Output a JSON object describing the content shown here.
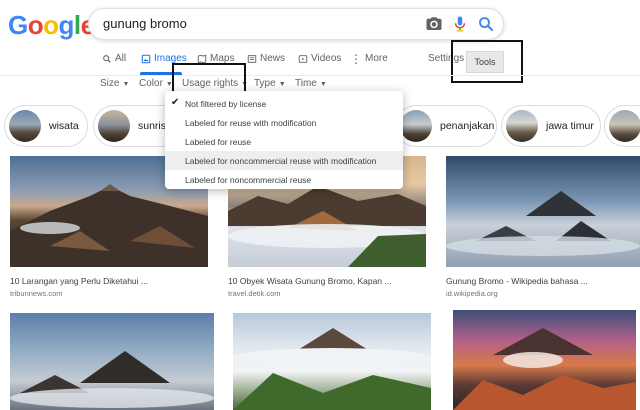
{
  "search": {
    "query": "gunung bromo"
  },
  "logo": {
    "letters": [
      "G",
      "o",
      "o",
      "g",
      "l",
      "e"
    ],
    "colors": [
      "#4285F4",
      "#EA4335",
      "#FBBC05",
      "#4285F4",
      "#34A853",
      "#EA4335"
    ]
  },
  "tabs": [
    {
      "label": "All",
      "icon": "search-icon"
    },
    {
      "label": "Images",
      "icon": "image-icon"
    },
    {
      "label": "Maps",
      "icon": "map-icon"
    },
    {
      "label": "News",
      "icon": "news-icon"
    },
    {
      "label": "Videos",
      "icon": "video-icon"
    },
    {
      "label": "More",
      "icon": "more-icon"
    }
  ],
  "settings_label": "Settings",
  "tools_label": "Tools",
  "filters": [
    {
      "label": "Size"
    },
    {
      "label": "Color"
    },
    {
      "label": "Usage rights"
    },
    {
      "label": "Type"
    },
    {
      "label": "Time"
    }
  ],
  "chips": [
    {
      "label": "wisata"
    },
    {
      "label": "sunrise"
    },
    {
      "label": "penanjakan"
    },
    {
      "label": "jawa timur"
    }
  ],
  "usage_menu": [
    {
      "label": "Not filtered by license",
      "checked": true
    },
    {
      "label": "Labeled for reuse with modification",
      "checked": false
    },
    {
      "label": "Labeled for reuse",
      "checked": false
    },
    {
      "label": "Labeled for noncommercial reuse with modification",
      "checked": false,
      "hover": true
    },
    {
      "label": "Labeled for noncommercial reuse",
      "checked": false
    }
  ],
  "results": [
    {
      "caption": "10 Larangan yang Perlu Diketahui ...",
      "source": "tribunnews.com"
    },
    {
      "caption": "10 Obyek Wisata Gunung Bromo, Kapan ...",
      "source": "travel.detik.com"
    },
    {
      "caption": "Gunung Bromo - Wikipedia bahasa ...",
      "source": "id.wikipedia.org"
    }
  ],
  "colors": {
    "accent": "#1a73e8",
    "mic_blue": "#4285F4",
    "mic_red": "#EA4335"
  }
}
